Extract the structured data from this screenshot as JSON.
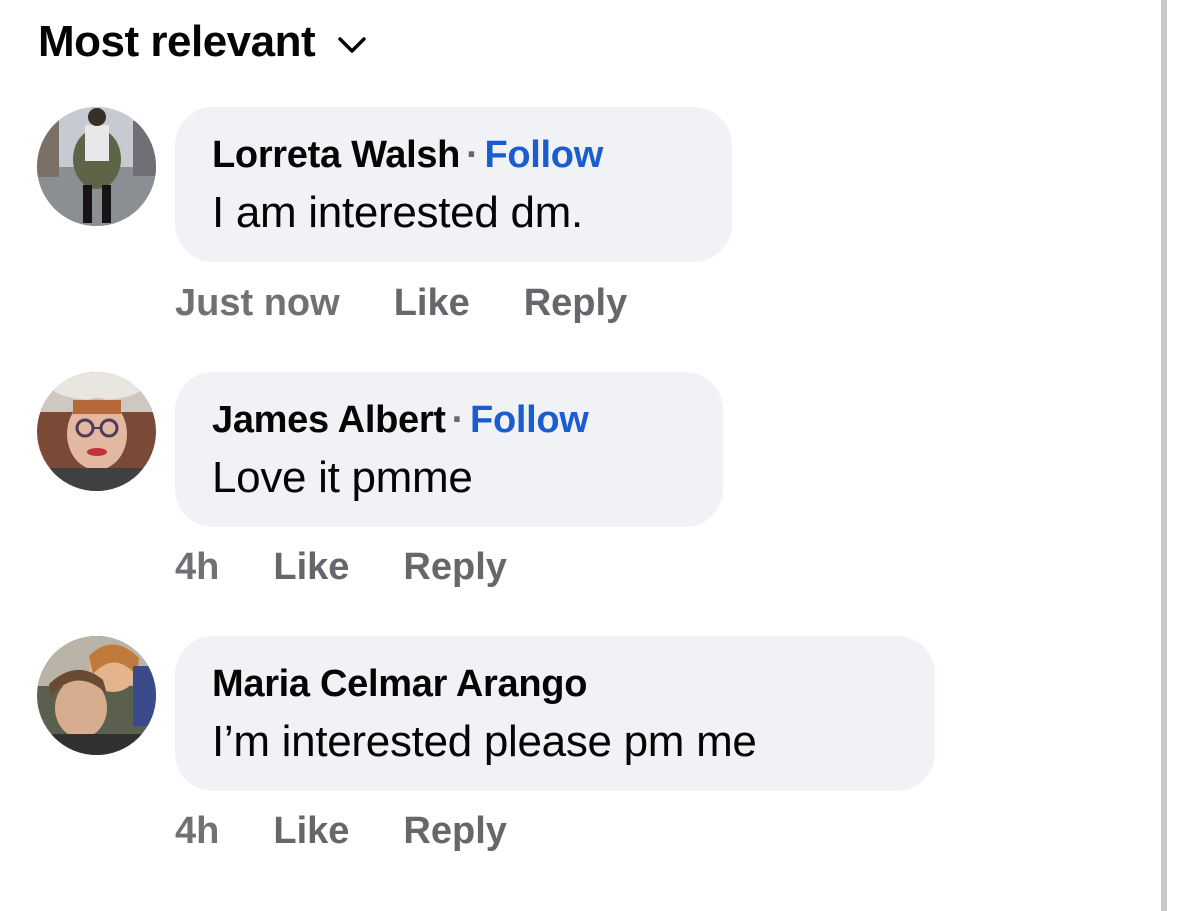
{
  "header": {
    "sort_label": "Most relevant"
  },
  "comments": [
    {
      "author": "Lorreta Walsh",
      "separator": "·",
      "follow": "Follow",
      "text": "I am interested dm.",
      "time": "Just now",
      "like": "Like",
      "reply": "Reply"
    },
    {
      "author": "James Albert",
      "separator": "·",
      "follow": "Follow",
      "text": "Love it pmme",
      "time": "4h",
      "like": "Like",
      "reply": "Reply"
    },
    {
      "author": "Maria Celmar Arango",
      "text": "I’m interested please pm me",
      "time": "4h",
      "like": "Like",
      "reply": "Reply"
    }
  ],
  "colors": {
    "follow": "#1b5dd0",
    "bubble": "#f0f2f5",
    "meta_text": "#65676b",
    "scrollbar": "#c9c9cb"
  },
  "icons": {
    "sort": "chevron-down-icon"
  }
}
